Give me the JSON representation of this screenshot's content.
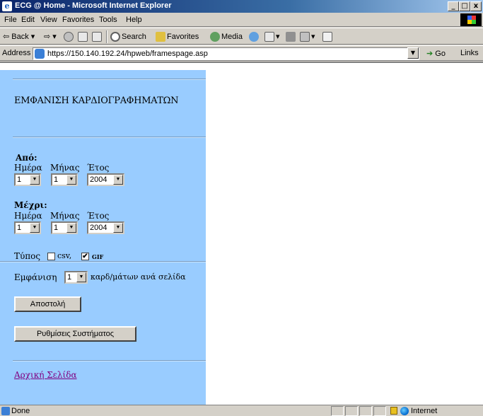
{
  "window": {
    "title": "ECG @ Home - Microsoft Internet Explorer",
    "minimize": "_",
    "maximize": "□",
    "close": "x"
  },
  "menu": [
    "File",
    "Edit",
    "View",
    "Favorites",
    "Tools",
    "Help"
  ],
  "toolbar": {
    "back": "⇦ Back ▾",
    "forward": "⇨ ▾",
    "search": "Search",
    "favorites": "Favorites",
    "media": "Media"
  },
  "address": {
    "label": "Address",
    "url": "https://150.140.192.24/hpweb/framespage.asp",
    "go": "Go",
    "links": "Links"
  },
  "form": {
    "heading": "ΕΜΦΑΝΙΣΗ ΚΑΡΔΙΟΓΡΑΦΗΜΑΤΩΝ",
    "from_label": "Από:",
    "to_label": "Μέχρι:",
    "day_label": "Ημέρα",
    "month_label": "Μήνας",
    "year_label": "Έτος",
    "from_day": "1",
    "from_month": "1",
    "from_year": "2004",
    "to_day": "1",
    "to_month": "1",
    "to_year": "2004",
    "type_label": "Τύπος",
    "csv_label": "csv,",
    "gif_label": "GIF",
    "csv_checked": false,
    "gif_checked": true,
    "show_label": "Εμφάνιση",
    "per_page_value": "1",
    "per_page_suffix": "καρδ/μάτων ανά σελίδα",
    "submit": "Αποστολή",
    "settings": "Ρυθμίσεις Συστήματος",
    "home_link": "Αρχική Σελίδα"
  },
  "status": {
    "text": "Done",
    "zone": "Internet"
  },
  "icons": {
    "dropdown": "▼",
    "check": "✔"
  }
}
